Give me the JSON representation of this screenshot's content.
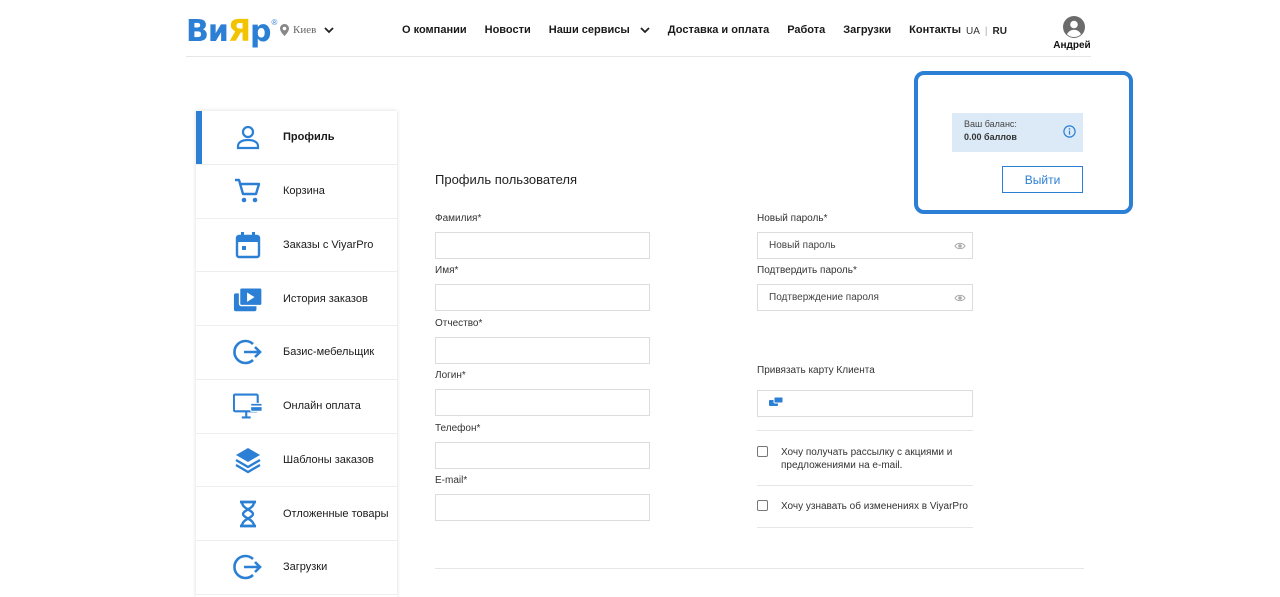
{
  "header": {
    "logo": {
      "text_part1": "Ви",
      "text_part2": "Я",
      "text_part3": "р",
      "reg": "®"
    },
    "city": "Киев",
    "nav": [
      {
        "label": "О компании"
      },
      {
        "label": "Новости"
      },
      {
        "label": "Наши сервисы",
        "has_dropdown": true
      },
      {
        "label": "Доставка и оплата"
      },
      {
        "label": "Работа"
      },
      {
        "label": "Загрузки"
      },
      {
        "label": "Контакты"
      }
    ],
    "lang": {
      "ua": "UA",
      "ru": "RU",
      "active": "RU"
    },
    "user_name": "Андрей"
  },
  "sidebar": {
    "items": [
      {
        "label": "Профиль",
        "icon": "user-icon",
        "active": true
      },
      {
        "label": "Корзина",
        "icon": "cart-icon"
      },
      {
        "label": "Заказы с ViyarPro",
        "icon": "calendar-icon"
      },
      {
        "label": "История заказов",
        "icon": "briefcase-play-icon"
      },
      {
        "label": "Базис-мебельщик",
        "icon": "logout-arrow-icon"
      },
      {
        "label": "Онлайн оплата",
        "icon": "monitor-card-icon"
      },
      {
        "label": "Шаблоны заказов",
        "icon": "layers-icon"
      },
      {
        "label": "Отложенные товары",
        "icon": "hourglass-icon"
      },
      {
        "label": "Загрузки",
        "icon": "logout-arrow-icon"
      }
    ]
  },
  "profile": {
    "title": "Профиль пользователя",
    "fields": {
      "last_name": {
        "label": "Фамилия*",
        "value": ""
      },
      "first_name": {
        "label": "Имя*",
        "value": ""
      },
      "patronymic": {
        "label": "Отчество*",
        "value": ""
      },
      "login": {
        "label": "Логин*",
        "value": ""
      },
      "phone": {
        "label": "Телефон*",
        "value": ""
      },
      "email": {
        "label": "E-mail*",
        "value": ""
      }
    },
    "new_password": {
      "label": "Новый пароль*",
      "placeholder": "Новый пароль"
    },
    "confirm_password": {
      "label": "Подтвердить пароль*",
      "placeholder": "Подтверждение пароля"
    },
    "card": {
      "label": "Привязать карту Клиента",
      "value": ""
    },
    "newsletter": {
      "label_line1": "Хочу получать рассылку с акциями и",
      "label_line2": "предложениями на e-mail.",
      "checked": false
    },
    "viyarpro_updates": {
      "label": "Хочу узнавать об изменениях в ViyarPro",
      "checked": false
    }
  },
  "balance": {
    "label": "Ваш баланс:",
    "value": "0.00 баллов",
    "logout_label": "Выйти"
  },
  "colors": {
    "accent": "#2b7fd4",
    "balance_bg": "#dce9f7",
    "logo_yellow": "#f2c400"
  }
}
